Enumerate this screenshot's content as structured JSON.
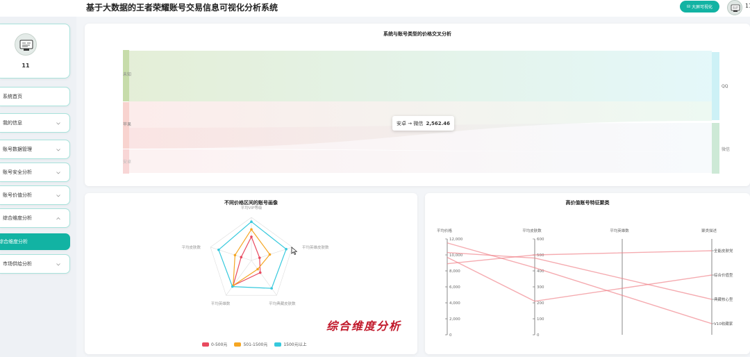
{
  "header": {
    "title": "基于大数据的王者荣耀账号交易信息可视化分析系统",
    "bigscreen_label": "大屏可视化",
    "username": "11"
  },
  "sidebar": {
    "profile_name": "11",
    "items": [
      {
        "label": "系统首页",
        "chevron": ""
      },
      {
        "label": "我的信息",
        "chevron": "down"
      },
      {
        "label": "账号数据管理",
        "chevron": "down"
      },
      {
        "label": "账号安全分析",
        "chevron": "down"
      },
      {
        "label": "账号价值分析",
        "chevron": "down"
      },
      {
        "label": "综合维度分析",
        "chevron": "up"
      },
      {
        "label": "综合维度分析",
        "chevron": "",
        "active": true
      },
      {
        "label": "市场供给分析",
        "chevron": "down"
      }
    ]
  },
  "sankey": {
    "title": "系统与账号类型的价格交叉分析",
    "left_nodes": [
      "未知",
      "苹果",
      "安卓"
    ],
    "right_nodes": [
      "QQ",
      "微信"
    ],
    "tooltip": {
      "label": "安卓 → 微信",
      "value": "2,562.46"
    }
  },
  "radar": {
    "title": "不同价格区间的账号画像",
    "indicators": [
      "平均VIP等级",
      "平均英雄皮肤数",
      "平均典藏皮肤数",
      "平均英雄数",
      "平均皮肤数"
    ],
    "series": [
      {
        "name": "0-500元",
        "color": "#e84a5f",
        "values": [
          0.55,
          0.2,
          0.35,
          0.72,
          0.25
        ]
      },
      {
        "name": "501-1500元",
        "color": "#f5a623",
        "values": [
          0.72,
          0.45,
          0.25,
          0.72,
          0.4
        ]
      },
      {
        "name": "1500元以上",
        "color": "#36c9dd",
        "values": [
          0.9,
          0.85,
          0.8,
          0.75,
          0.8
        ]
      }
    ],
    "legend": [
      "0-500元",
      "501-1500元",
      "1500元以上"
    ]
  },
  "parallel": {
    "title": "高价值账号特征聚类",
    "axes": [
      {
        "name": "平均价格",
        "ticks": [
          "12,000",
          "10,000",
          "8,000",
          "6,000",
          "4,000",
          "2,000",
          "0"
        ]
      },
      {
        "name": "平均皮肤数",
        "ticks": [
          "600",
          "500",
          "400",
          "300",
          "200",
          "100",
          "0"
        ]
      },
      {
        "name": "平均英雄数",
        "ticks": []
      },
      {
        "name": "聚类描述",
        "ticks": [
          "全能皮肤党",
          "综合价值型",
          "典藏核心型",
          "V10收藏家"
        ]
      }
    ],
    "lines": [
      {
        "values": [
          11500,
          420,
          "V10收藏家"
        ]
      },
      {
        "values": [
          10300,
          480,
          "典藏核心型"
        ]
      },
      {
        "values": [
          8900,
          500,
          "全能皮肤党"
        ]
      },
      {
        "values": [
          9700,
          210,
          "综合价值型"
        ]
      }
    ]
  },
  "watermark": "综合维度分析"
}
